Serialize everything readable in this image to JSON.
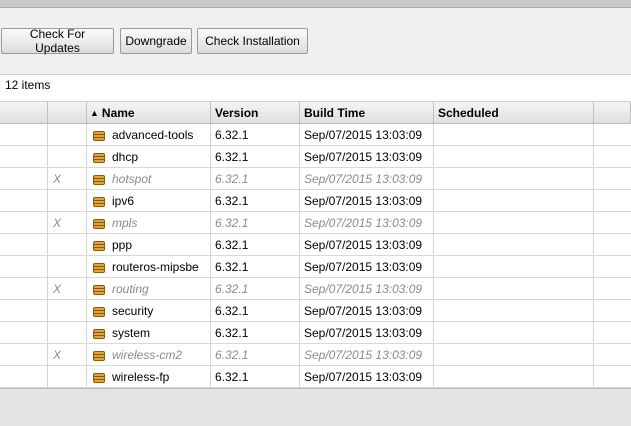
{
  "toolbar": {
    "check_updates": "Check For Updates",
    "downgrade": "Downgrade",
    "check_installation": "Check Installation"
  },
  "status": {
    "items_count": "12 items"
  },
  "table": {
    "headers": {
      "flag": "",
      "name": "Name",
      "version": "Version",
      "build_time": "Build Time",
      "scheduled": "Scheduled"
    },
    "sort": {
      "column": "Name",
      "direction": "ascending"
    },
    "rows": [
      {
        "flag": "",
        "name": "advanced-tools",
        "version": "6.32.1",
        "build_time": "Sep/07/2015 13:03:09",
        "scheduled": "",
        "disabled": false
      },
      {
        "flag": "",
        "name": "dhcp",
        "version": "6.32.1",
        "build_time": "Sep/07/2015 13:03:09",
        "scheduled": "",
        "disabled": false
      },
      {
        "flag": "X",
        "name": "hotspot",
        "version": "6.32.1",
        "build_time": "Sep/07/2015 13:03:09",
        "scheduled": "",
        "disabled": true
      },
      {
        "flag": "",
        "name": "ipv6",
        "version": "6.32.1",
        "build_time": "Sep/07/2015 13:03:09",
        "scheduled": "",
        "disabled": false
      },
      {
        "flag": "X",
        "name": "mpls",
        "version": "6.32.1",
        "build_time": "Sep/07/2015 13:03:09",
        "scheduled": "",
        "disabled": true
      },
      {
        "flag": "",
        "name": "ppp",
        "version": "6.32.1",
        "build_time": "Sep/07/2015 13:03:09",
        "scheduled": "",
        "disabled": false
      },
      {
        "flag": "",
        "name": "routeros-mipsbe",
        "version": "6.32.1",
        "build_time": "Sep/07/2015 13:03:09",
        "scheduled": "",
        "disabled": false
      },
      {
        "flag": "X",
        "name": "routing",
        "version": "6.32.1",
        "build_time": "Sep/07/2015 13:03:09",
        "scheduled": "",
        "disabled": true
      },
      {
        "flag": "",
        "name": "security",
        "version": "6.32.1",
        "build_time": "Sep/07/2015 13:03:09",
        "scheduled": "",
        "disabled": false
      },
      {
        "flag": "",
        "name": "system",
        "version": "6.32.1",
        "build_time": "Sep/07/2015 13:03:09",
        "scheduled": "",
        "disabled": false
      },
      {
        "flag": "X",
        "name": "wireless-cm2",
        "version": "6.32.1",
        "build_time": "Sep/07/2015 13:03:09",
        "scheduled": "",
        "disabled": true
      },
      {
        "flag": "",
        "name": "wireless-fp",
        "version": "6.32.1",
        "build_time": "Sep/07/2015 13:03:09",
        "scheduled": "",
        "disabled": false
      }
    ]
  },
  "icons": {
    "package": "package-icon",
    "sort": "sort-ascending-icon"
  },
  "colors": {
    "package_icon": "#c98a1a",
    "disabled_text": "#8a8a8a",
    "background": "#e4e4e4"
  }
}
